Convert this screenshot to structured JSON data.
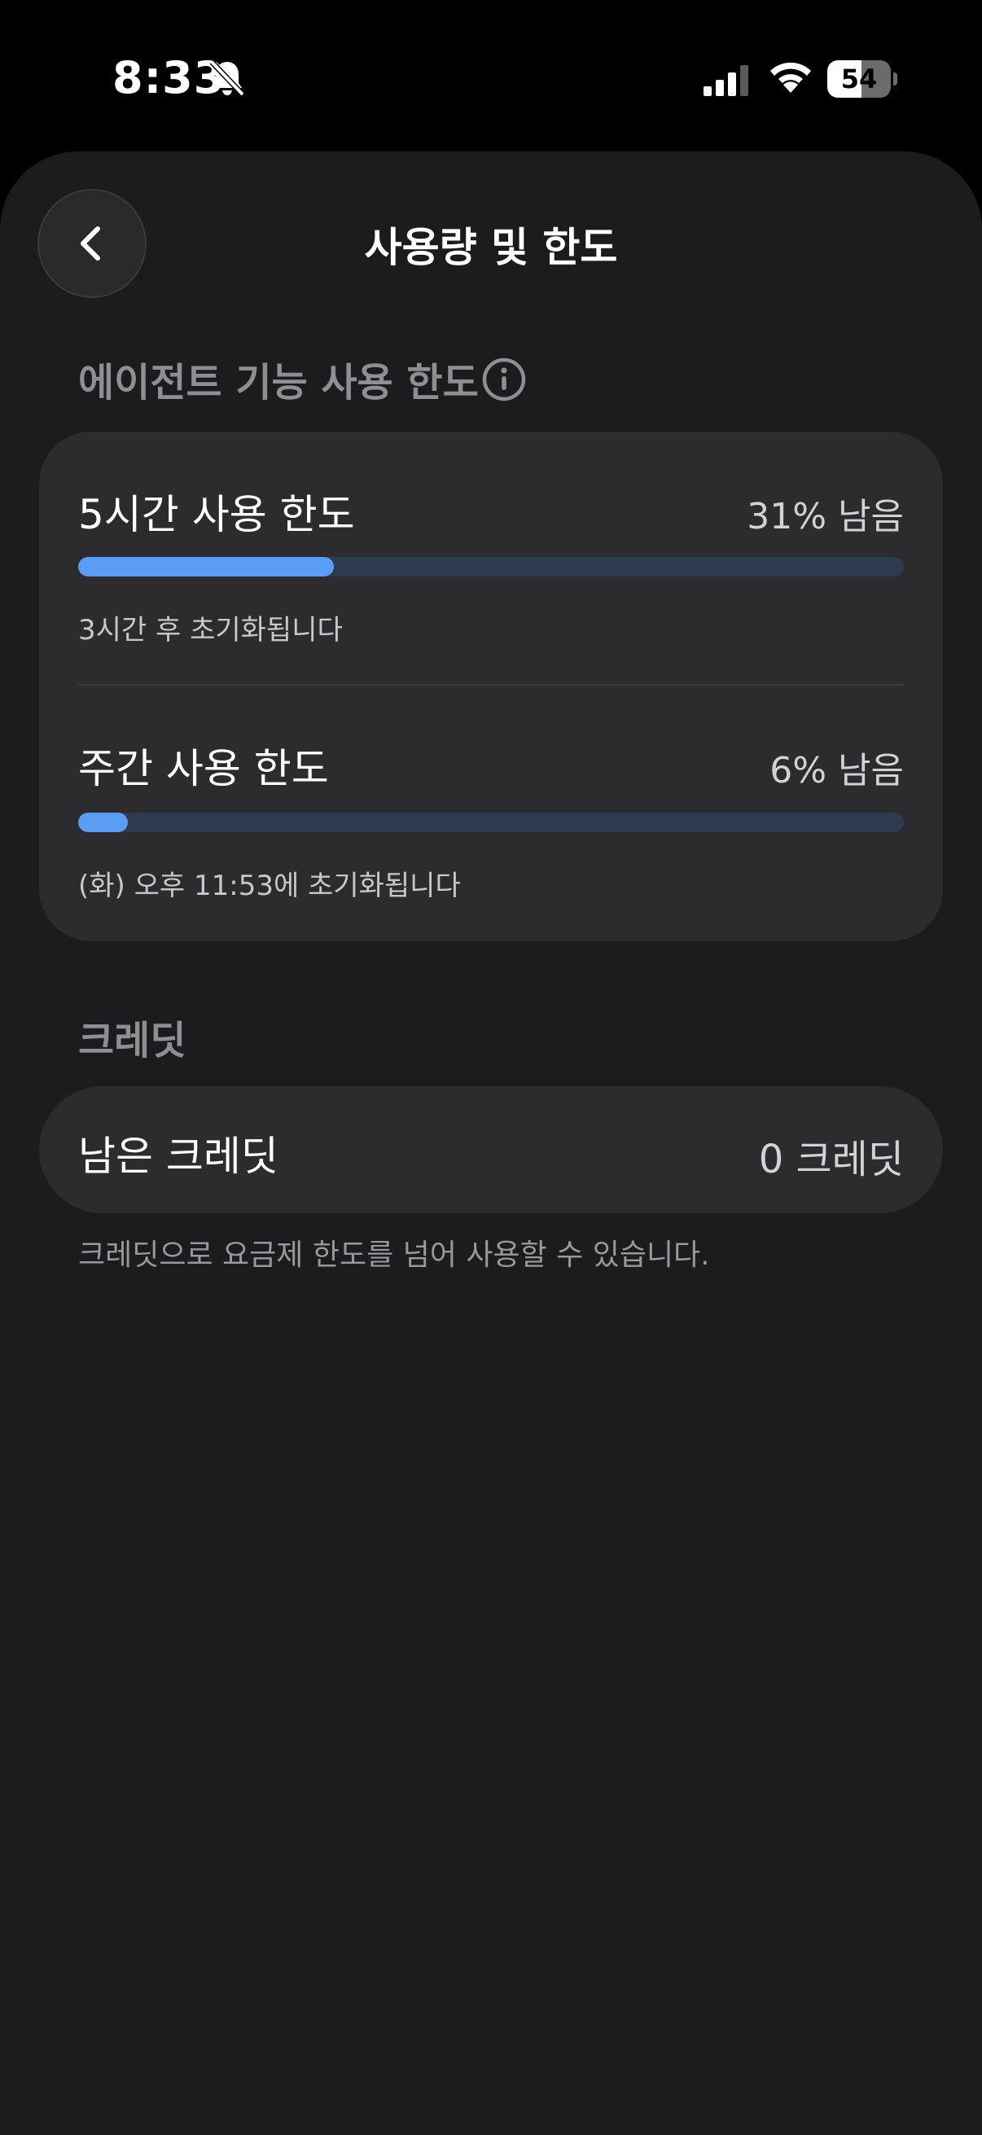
{
  "status_bar": {
    "time": "8:33",
    "battery_level": "54",
    "battery_fraction": 0.54
  },
  "header": {
    "title": "사용량 및 한도",
    "back_icon": "chevron-left-icon"
  },
  "agent_limits": {
    "section_label": "에이전트 기능 사용 한도",
    "info_icon": "info-icon",
    "rows": [
      {
        "title": "5시간 사용 한도",
        "value": "31% 남음",
        "progress_fraction": 0.31,
        "reset_text": "3시간 후 초기화됩니다"
      },
      {
        "title": "주간 사용 한도",
        "value": "6% 남음",
        "progress_fraction": 0.06,
        "reset_text": "(화) 오후 11:53에 초기화됩니다"
      }
    ]
  },
  "credits": {
    "section_label": "크레딧",
    "row_title": "남은 크레딧",
    "row_value": "0 크레딧",
    "footnote": "크레딧으로 요금제 한도를 넘어 사용할 수 있습니다."
  },
  "colors": {
    "accent": "#5b9cf5",
    "track": "#2e3a4d",
    "background": "#1c1c1e",
    "card": "#2c2c2e"
  }
}
